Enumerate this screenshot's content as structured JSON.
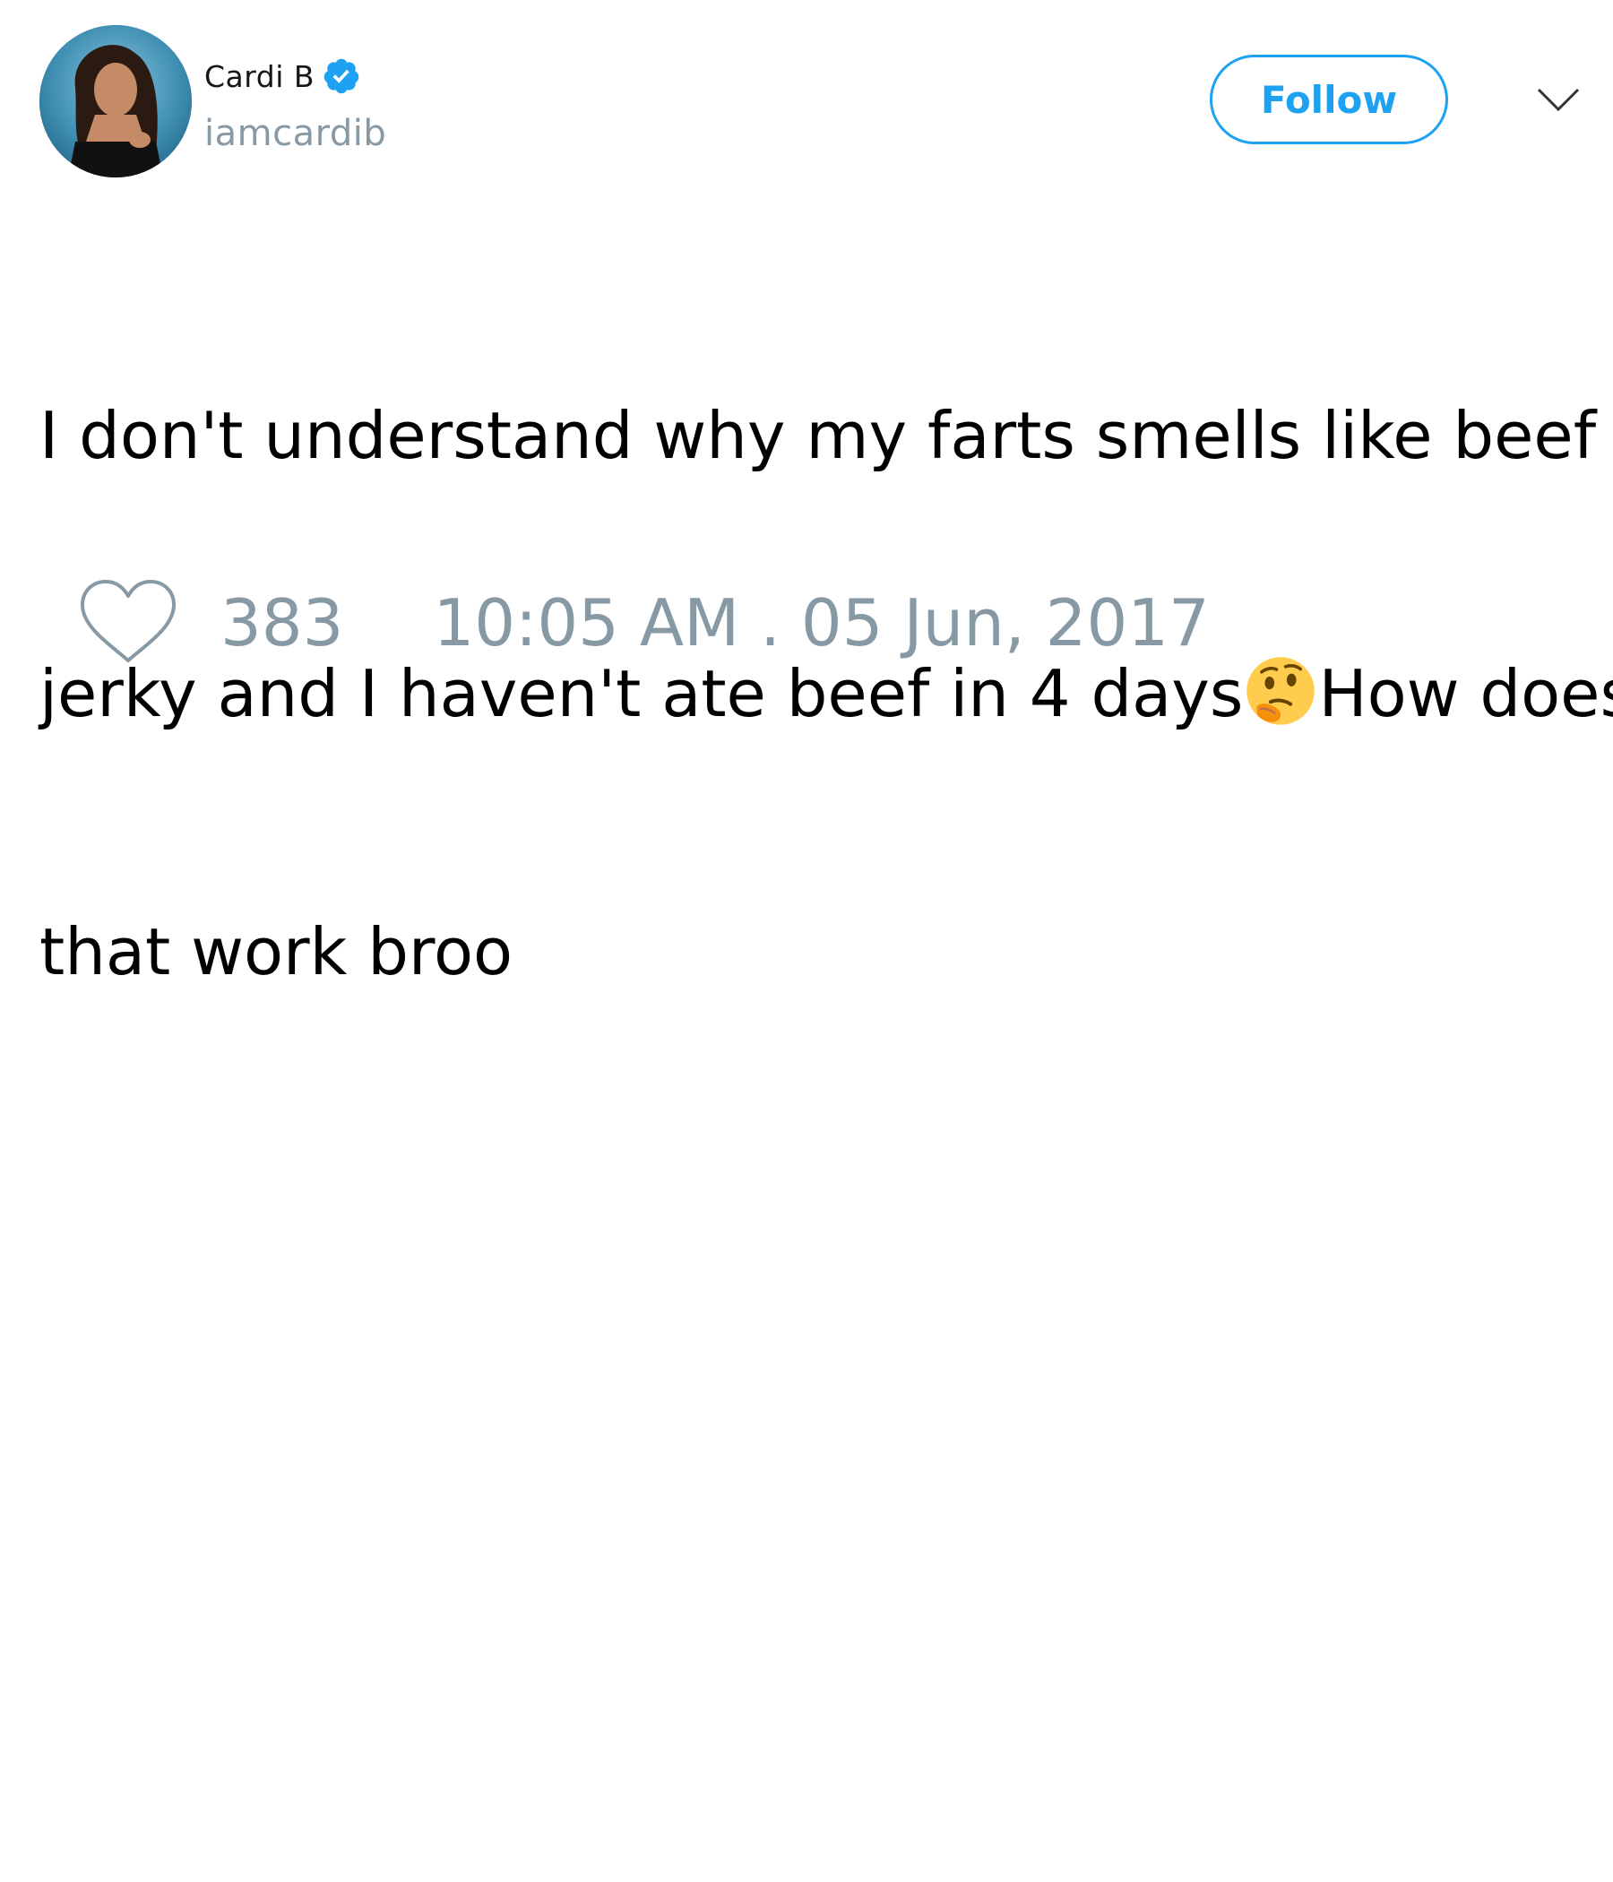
{
  "user": {
    "display_name": "Cardi B",
    "username": "iamcardib",
    "verified": true
  },
  "actions": {
    "follow_label": "Follow"
  },
  "tweet": {
    "text_lines": [
      "I don't understand why my farts smells like beef",
      "jerky and I haven't ate beef in 4 days",
      "How does",
      "that work broo"
    ],
    "emoji": "thinking-face"
  },
  "footer": {
    "like_count": "383",
    "timestamp": "10:05 AM . 05 Jun, 2017"
  },
  "colors": {
    "accent": "#1da1f2",
    "muted_text": "#8899a6",
    "primary_text": "#000000",
    "background": "#ffffff"
  },
  "icons": [
    "verified-badge-icon",
    "chevron-down-icon",
    "heart-icon",
    "thinking-face-emoji"
  ]
}
